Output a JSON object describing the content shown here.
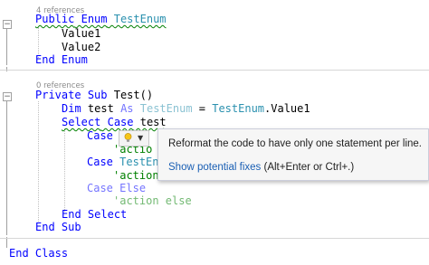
{
  "editor": {
    "refs_enum": "4 references",
    "refs_sub": "0 references",
    "lines": {
      "enum_public": "Public",
      "enum_kw": "Enum",
      "enum_name": "TestEnum",
      "value1": "Value1",
      "value2": "Value2",
      "end_enum_end": "End",
      "end_enum_enum": "Enum",
      "private": "Private",
      "sub": "Sub",
      "sub_name": "Test()",
      "dim": "Dim",
      "dim_var": "test",
      "as": "As",
      "dim_type": "TestEnum",
      "dim_eq": " = ",
      "dim_value_type": "TestEnum",
      "dim_value_member": ".Value1",
      "select": "Select",
      "case": "Case",
      "select_var": "test",
      "case1_kw": "Case",
      "case1_rest": "n",
      "comment1": "'actio",
      "case2_kw": "Case",
      "case2_rest": "TestEn",
      "comment2": "'action",
      "case_else_case": "Case",
      "case_else_else": "Else",
      "comment3": "'action else",
      "end_select_end": "End",
      "end_select_select": "Select",
      "end_sub_end": "End",
      "end_sub_sub": "Sub",
      "end_class_end": "End",
      "end_class_class": "Class"
    }
  },
  "quick_action": {
    "message": "Reformat the code to have only one statement per line.",
    "show_fixes_link": "Show potential fixes",
    "show_fixes_shortcut": " (Alt+Enter or Ctrl+.)",
    "bulb_icon": "lightbulb-icon",
    "dropdown_icon": "chevron-down-icon"
  },
  "colors": {
    "keyword": "#0000ff",
    "type": "#2b91af",
    "comment": "#008000",
    "link": "#1a5fb4"
  }
}
